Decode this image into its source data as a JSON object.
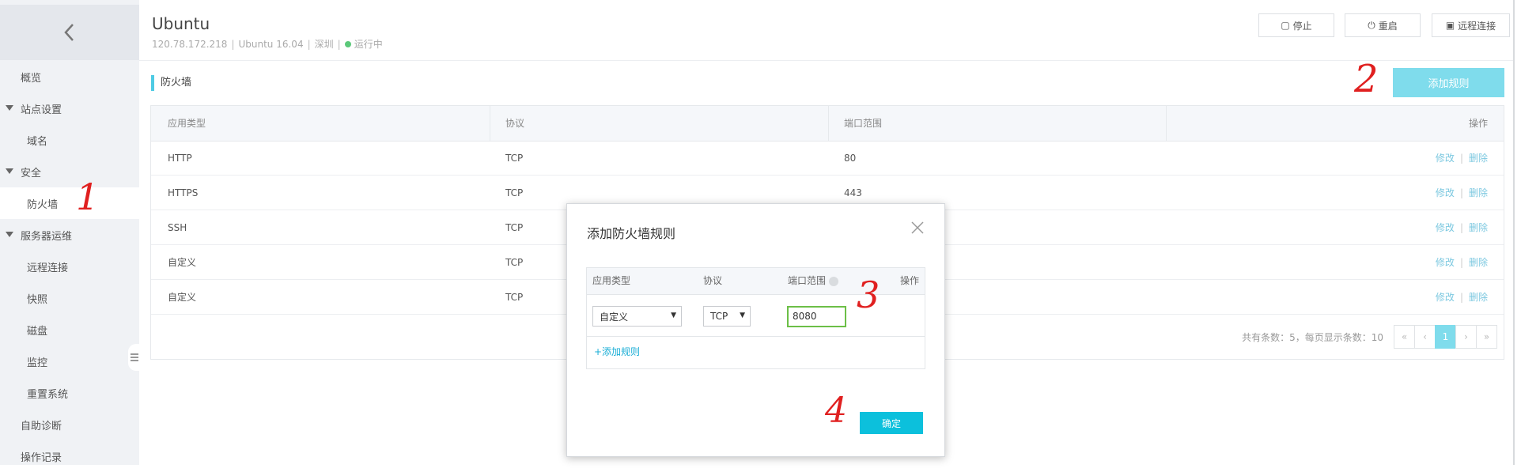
{
  "header": {
    "instance_name": "Ubuntu",
    "ip": "120.78.172.218",
    "os": "Ubuntu 16.04",
    "region": "深圳",
    "status": "运行中",
    "separator": "|",
    "buttons": {
      "stop": "停止",
      "restart": "重启",
      "remote": "远程连接"
    }
  },
  "sidebar": {
    "items": [
      {
        "label": "概览"
      },
      {
        "label": "站点设置"
      },
      {
        "label": "域名"
      },
      {
        "label": "安全"
      },
      {
        "label": "防火墙"
      },
      {
        "label": "服务器运维"
      },
      {
        "label": "远程连接"
      },
      {
        "label": "快照"
      },
      {
        "label": "磁盘"
      },
      {
        "label": "监控"
      },
      {
        "label": "重置系统"
      },
      {
        "label": "自助诊断"
      },
      {
        "label": "操作记录"
      }
    ]
  },
  "main": {
    "section_title": "防火墙",
    "add_rule_button": "添加规则",
    "table": {
      "columns": [
        "应用类型",
        "协议",
        "端口范围",
        "操作"
      ],
      "rows": [
        {
          "type": "HTTP",
          "protocol": "TCP",
          "port": "80"
        },
        {
          "type": "HTTPS",
          "protocol": "TCP",
          "port": "443"
        },
        {
          "type": "SSH",
          "protocol": "TCP",
          "port": ""
        },
        {
          "type": "自定义",
          "protocol": "TCP",
          "port": ""
        },
        {
          "type": "自定义",
          "protocol": "TCP",
          "port": ""
        }
      ],
      "action_edit": "修改",
      "action_delete": "删除",
      "action_sep": "|"
    },
    "pagination": {
      "info": "共有条数：5，每页显示条数：10",
      "first": "«",
      "prev": "‹",
      "current": "1",
      "next": "›",
      "last": "»"
    }
  },
  "modal": {
    "title": "添加防火墙规则",
    "columns": [
      "应用类型",
      "协议",
      "端口范围",
      "操作"
    ],
    "type_value": "自定义",
    "protocol_value": "TCP",
    "port_value": "8080",
    "add_rule_link": "+添加规则",
    "confirm_button": "确定"
  },
  "annotations": [
    "1",
    "2",
    "3",
    "4"
  ],
  "icons": {
    "back": "chevron-left-icon",
    "stop": "square-icon",
    "restart": "power-icon",
    "remote": "monitor-icon",
    "close": "close-icon",
    "help": "help-icon",
    "collapse": "list-icon"
  },
  "colors": {
    "accent": "#7fdcec",
    "confirm": "#0cc0dc",
    "link": "#7cc8e0",
    "status_ok": "#5cc97a",
    "annotation": "#e02020"
  }
}
